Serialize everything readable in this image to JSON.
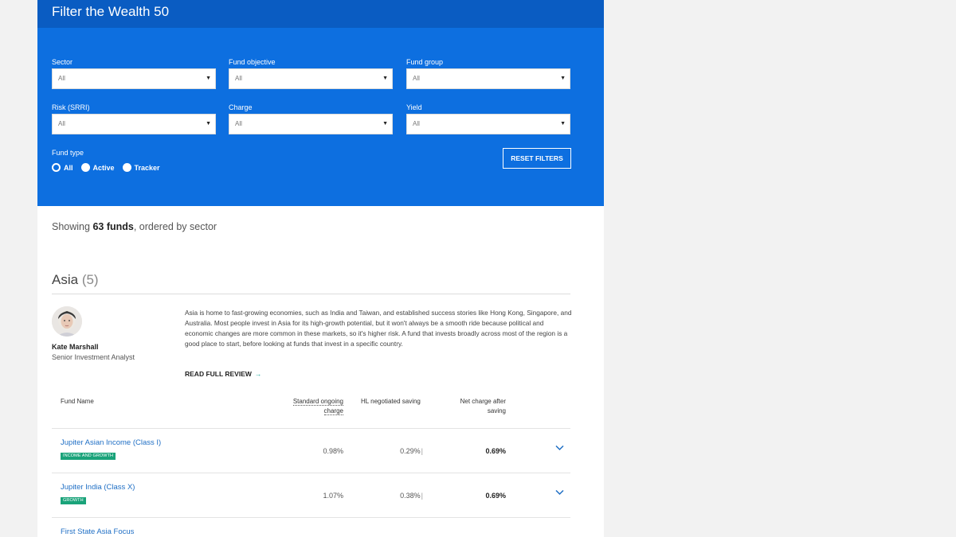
{
  "header": {
    "title": "Filter the Wealth 50"
  },
  "filters": {
    "sector": {
      "label": "Sector",
      "value": "All"
    },
    "fund_objective": {
      "label": "Fund objective",
      "value": "All"
    },
    "fund_group": {
      "label": "Fund group",
      "value": "All"
    },
    "risk": {
      "label": "Risk (SRRI)",
      "value": "All"
    },
    "charge": {
      "label": "Charge",
      "value": "All"
    },
    "yield": {
      "label": "Yield",
      "value": "All"
    },
    "dropdown_arrow": "▼",
    "fund_type": {
      "label": "Fund type",
      "options": [
        "All",
        "Active",
        "Tracker"
      ],
      "selected": "All"
    },
    "reset_label": "RESET FILTERS"
  },
  "results": {
    "prefix": "Showing ",
    "count": "63 funds",
    "suffix": ", ordered by sector"
  },
  "sector": {
    "name": "Asia",
    "count": "(5)",
    "analyst": {
      "name": "Kate Marshall",
      "role": "Senior Investment Analyst"
    },
    "review": "Asia is home to fast-growing economies, such as India and Taiwan, and established success stories like Hong Kong, Singapore, and Australia. Most people invest in Asia for its high-growth potential, but it won't always be a smooth ride because political and economic changes are more common in these markets, so it's higher risk. A fund that invests broadly across most of the region is a good place to start, before looking at funds that invest in a specific country.",
    "read_more": "READ FULL REVIEW",
    "read_more_arrow": "→"
  },
  "table": {
    "headers": {
      "fund_name": "Fund Name",
      "ongoing_charge_1": "Standard ongoing",
      "ongoing_charge_2": "charge",
      "hl_saving": "HL negotiated saving",
      "net_charge_1": "Net charge after",
      "net_charge_2": "saving"
    },
    "rows": [
      {
        "name": "Jupiter Asian Income (Class I)",
        "badge": "INCOME AND GROWTH",
        "ongoing": "0.98%",
        "saving": "0.29%",
        "net": "0.69%"
      },
      {
        "name": "Jupiter India (Class X)",
        "badge": "GROWTH",
        "ongoing": "1.07%",
        "saving": "0.38%",
        "net": "0.69%"
      },
      {
        "name": "First State Asia Focus"
      }
    ],
    "saving_marker": "|",
    "expand_icon": "chevron-down-icon"
  },
  "colors": {
    "header_bg": "#0a5cc2",
    "panel_bg": "#0d6fe0",
    "link": "#1f6fc5",
    "badge": "#1aa37a",
    "accent_arrow": "#1aa89b"
  }
}
